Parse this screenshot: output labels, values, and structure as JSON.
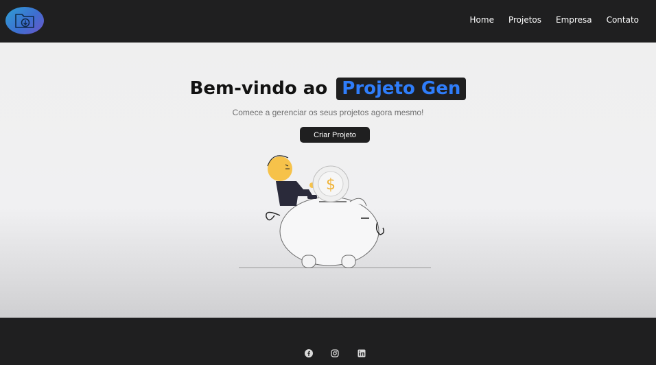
{
  "navbar": {
    "logo_icon": "folder-download-icon",
    "links": [
      "Home",
      "Projetos",
      "Empresa",
      "Contato"
    ]
  },
  "hero": {
    "title_prefix": "Bem-vindo ao",
    "title_highlight": "Projeto Gen",
    "subtitle": "Comece a gerenciar os seus projetos agora mesmo!",
    "cta_label": "Criar Projeto",
    "illustration": "person-coin-piggy-bank-illustration",
    "coin_symbol": "$"
  },
  "footer": {
    "social_icons": [
      "facebook-icon",
      "instagram-icon",
      "linkedin-icon"
    ]
  },
  "colors": {
    "highlight_text": "#2f7dfa",
    "dark": "#1f1f20"
  }
}
